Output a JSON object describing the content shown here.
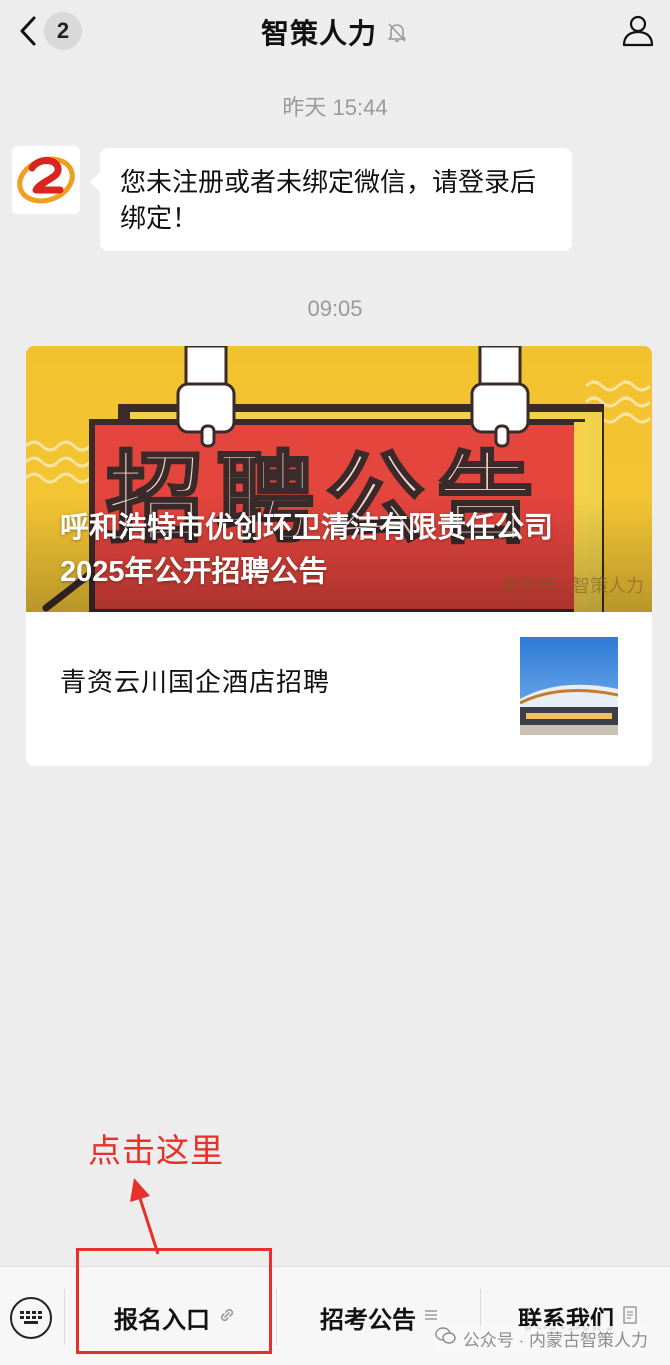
{
  "header": {
    "title": "智策人力",
    "unread_count": "2"
  },
  "messages": {
    "timestamp_1": "昨天 15:44",
    "bubble_text": "您未注册或者未绑定微信，请登录后绑定！",
    "timestamp_2": "09:05"
  },
  "article": {
    "cover_banner_text": "招聘公告",
    "cover_title_line1": "呼和浩特市优创环卫清洁有限责任公司",
    "cover_title_line2": "2025年公开招聘公告",
    "cover_watermark": "服务号 · 智策人力",
    "sub_title": "青资云川国企酒店招聘"
  },
  "annotation": {
    "text": "点击这里"
  },
  "menu": {
    "items": [
      {
        "label": "报名入口",
        "icon": "link-icon"
      },
      {
        "label": "招考公告",
        "icon": "list-icon"
      },
      {
        "label": "联系我们",
        "icon": "doc-icon"
      }
    ]
  },
  "footer": {
    "watermark": "公众号 · 内蒙古智策人力"
  },
  "colors": {
    "background": "#ededed",
    "annotation_red": "#e8302a",
    "cover_yellow": "#f2c12e",
    "banner_red": "#e4453d"
  }
}
